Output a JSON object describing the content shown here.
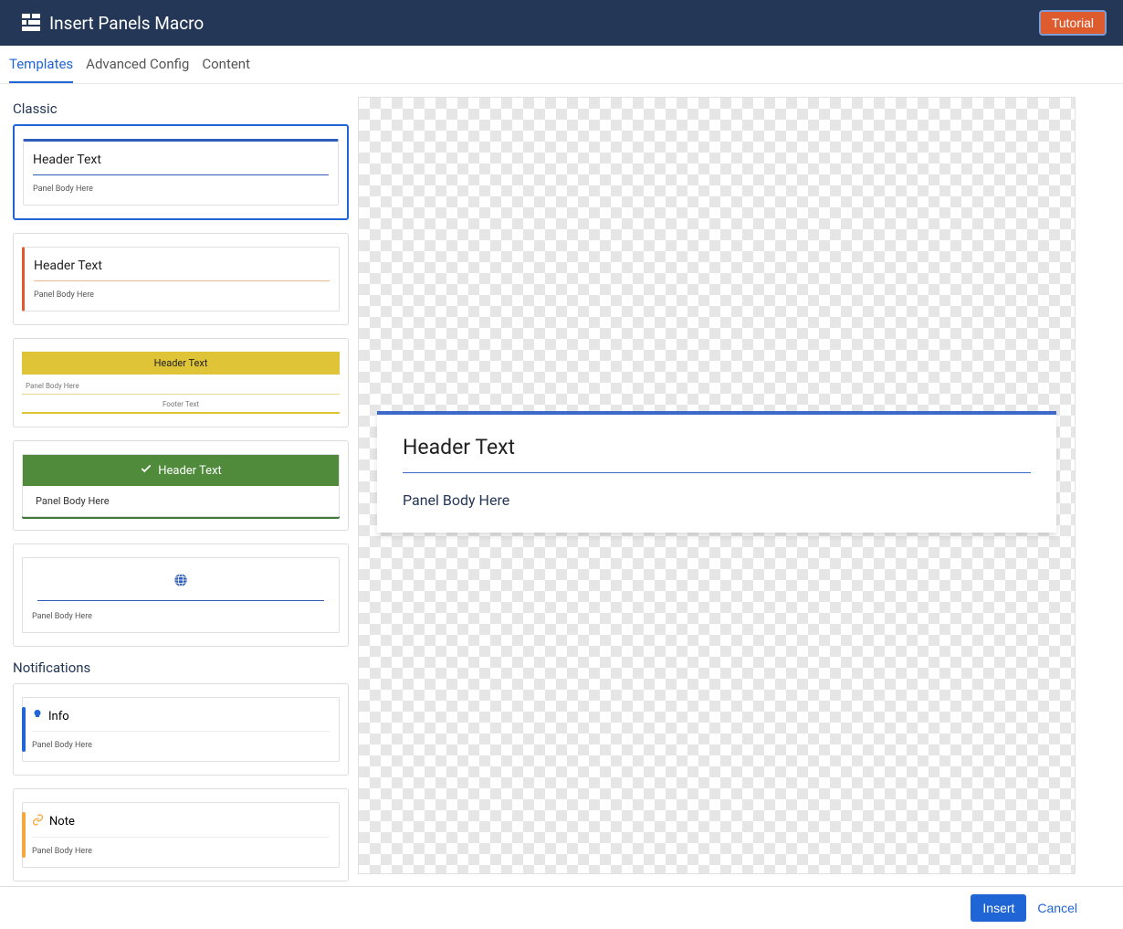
{
  "header": {
    "title": "Insert Panels Macro",
    "tutorial_button": "Tutorial"
  },
  "tabs": {
    "templates": "Templates",
    "advanced": "Advanced Config",
    "content": "Content",
    "active": "templates"
  },
  "sections": {
    "classic": {
      "title": "Classic",
      "templates": [
        {
          "style": "blue_top",
          "header": "Header Text",
          "body": "Panel Body Here",
          "selected": true
        },
        {
          "style": "orange_left",
          "header": "Header Text",
          "body": "Panel Body Here"
        },
        {
          "style": "yellow_full",
          "header": "Header Text",
          "body": "Panel Body Here",
          "footer": "Footer Text"
        },
        {
          "style": "green_check",
          "header": "Header Text",
          "body": "Panel Body Here",
          "icon": "check"
        },
        {
          "style": "globe",
          "body": "Panel Body Here",
          "icon": "globe"
        }
      ]
    },
    "notifications": {
      "title": "Notifications",
      "templates": [
        {
          "style": "info_blue",
          "header": "Info",
          "body": "Panel Body Here",
          "icon": "bulb"
        },
        {
          "style": "note_orange",
          "header": "Note",
          "body": "Panel Body Here",
          "icon": "link"
        }
      ]
    }
  },
  "preview": {
    "header": "Header Text",
    "body": "Panel Body Here"
  },
  "footer": {
    "insert": "Insert",
    "cancel": "Cancel"
  }
}
